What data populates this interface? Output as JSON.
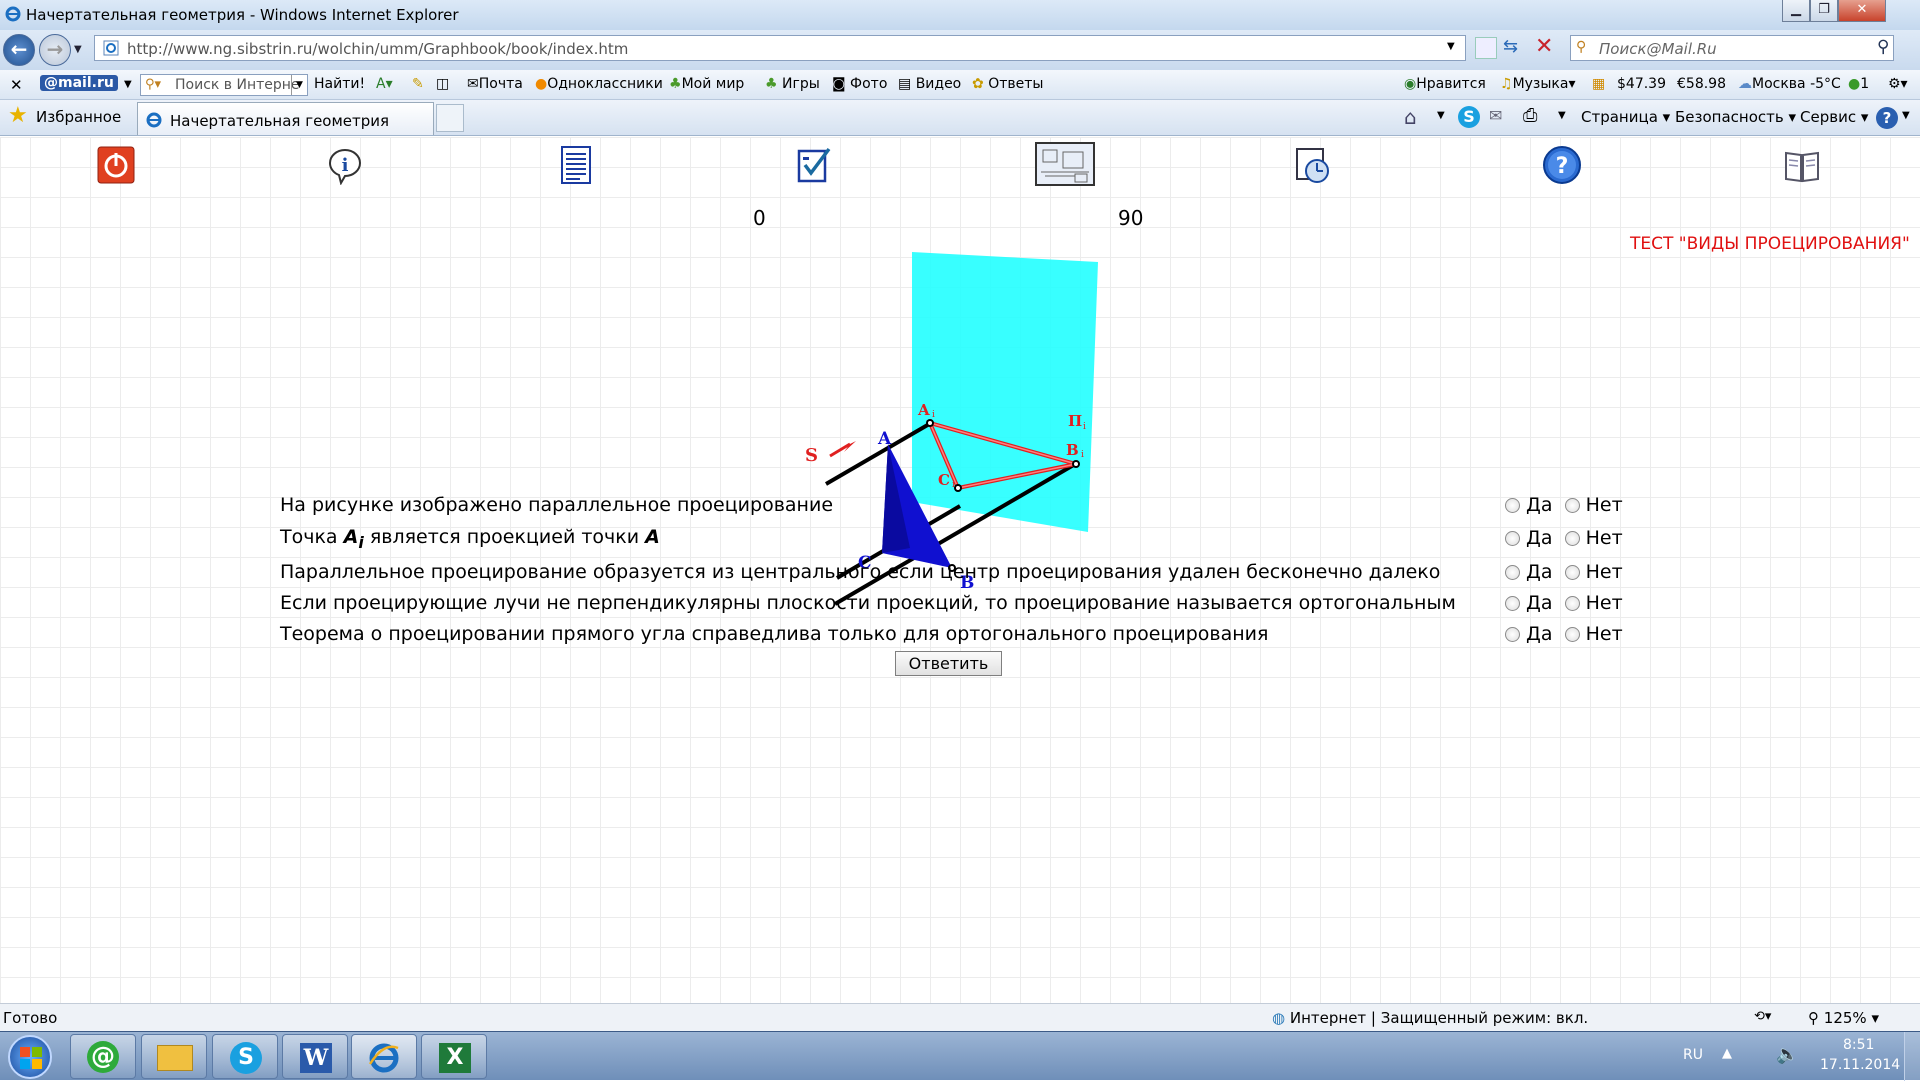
{
  "window": {
    "title": "Начертательная геометрия - Windows Internet Explorer"
  },
  "address": {
    "url": "http://www.ng.sibstrin.ru/wolchin/umm/Graphbook/book/index.htm",
    "search_placeholder": "Поиск@Mail.Ru"
  },
  "toolbar": {
    "mail_logo": "@mail.ru",
    "search_placeholder": "Поиск в Интерне",
    "find": "Найти!",
    "links": [
      "Почта",
      "Одноклассники",
      "Мой мир",
      "Игры",
      "Фото",
      "Видео",
      "Ответы"
    ],
    "likes": "Нравится",
    "music": "Музыка",
    "usd": "$47.39",
    "eur": "€58.98",
    "weather": "Москва -5°C",
    "count": "1"
  },
  "favorites": {
    "label": "Избранное",
    "tab": "Начертательная геометрия",
    "menus": [
      "Страница",
      "Безопасность",
      "Сервис"
    ]
  },
  "page": {
    "score_left": "0",
    "score_right": "90",
    "test_title": "ТЕСТ \"ВИДЫ ПРОЕЦИРОВАНИЯ\"",
    "questions": [
      "На рисунке изображено параллельное проецирование",
      "является проекцией точки",
      "Параллельное проецирование образуется из центрального если центр проецирования удален бесконечно далеко",
      "Если проецирующие лучи не перпендикулярны плоскости проекций, то проецирование называется ортогональным",
      "Теорема о проецировании прямого угла справедлива только для ортогонального проецирования"
    ],
    "q2": {
      "prefix": "Точка",
      "point1": "A",
      "sub1": "i",
      "point2": "A"
    },
    "yes": "Да",
    "no": "Нет",
    "submit": "Ответить",
    "figure": {
      "plane": "П",
      "plane_sub": "i",
      "s": "S",
      "a": "A",
      "b": "B",
      "c": "C",
      "a1": "A",
      "b1": "B",
      "c1": "C",
      "sub": "i"
    }
  },
  "status": {
    "left": "Готово",
    "zone": "Интернет | Защищенный режим: вкл.",
    "zoom": "125%"
  },
  "taskbar": {
    "lang": "RU",
    "time": "8:51",
    "date": "17.11.2014"
  }
}
